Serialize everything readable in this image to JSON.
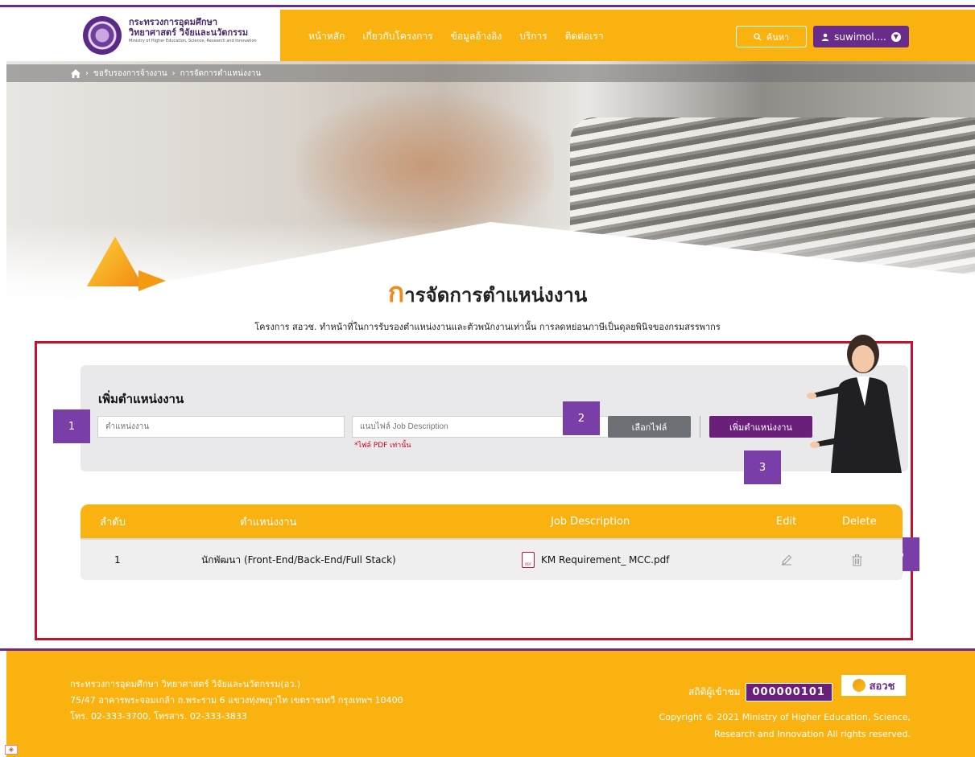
{
  "header": {
    "org_th_1": "กระทรวงการอุดมศึกษา",
    "org_th_2": "วิทยาศาสตร์ วิจัยและนวัตกรรม",
    "org_en": "Ministry of Higher Education, Science, Research and Innovation",
    "nav": [
      "หน้าหลัก",
      "เกี่ยวกับโครงการ",
      "ข้อมูลอ้างอิง",
      "บริการ",
      "ติดต่อเรา"
    ],
    "search_label": "ค้นหา",
    "user_label": "suwimol....",
    "brand_color": "#f9b20f",
    "accent_color": "#6a2c8a"
  },
  "breadcrumb": {
    "items": [
      "ขอรับรองการจ้างงาน",
      "การจัดการตำแหน่งงาน"
    ]
  },
  "page": {
    "title_cap": "ก",
    "title_rest": "ารจัดการตำแหน่งงาน",
    "subtitle": "โครงการ สอวช. ทำหน้าที่ในการรับรองตำแหน่งงานและตัวพนักงานเท่านั้น การลดหย่อนภาษีเป็นดุลยพินิจของกรมสรรพากร"
  },
  "form": {
    "heading": "เพิ่มตำแหน่งงาน",
    "position_placeholder": "ตำแหน่งงาน",
    "file_placeholder": "แนบไฟล์ Job Description",
    "file_note": "*ไฟล์ PDF เท่านั้น",
    "choose_file": "เลือกไฟล์",
    "add_position": "เพิ่มตำแหน่งงาน"
  },
  "badges": [
    "1",
    "2",
    "3",
    "4",
    "5"
  ],
  "table": {
    "headers": {
      "no": "ลำดับ",
      "position": "ตำแหน่งงาน",
      "jd": "Job Description",
      "edit": "Edit",
      "delete": "Delete"
    },
    "rows": [
      {
        "no": "1",
        "position": "นักพัฒนา (Front-End/Back-End/Full Stack)",
        "jd": "KM Requirement_ MCC.pdf"
      }
    ]
  },
  "footer": {
    "addr1": "กระทรวงการอุดมศึกษา วิทยาศาสตร์ วิจัยและนวัตกรรม(อว.)",
    "addr2": "75/47 อาคารพระจอมเกล้า ถ.พระราม 6 แขวงทุ่งพญาไท เขตราชเทวี กรุงเทพฯ 10400",
    "addr3": "โทร. 02-333-3700, โทรสาร. 02-333-3833",
    "visit_label": "สถิติผู้เข้าชม",
    "visit_count": "000000101",
    "brand": "สอวช",
    "copy1": "Copyright © 2021 Ministry of Higher Education, Science,",
    "copy2": "Research and Innovation All rights reserved."
  }
}
